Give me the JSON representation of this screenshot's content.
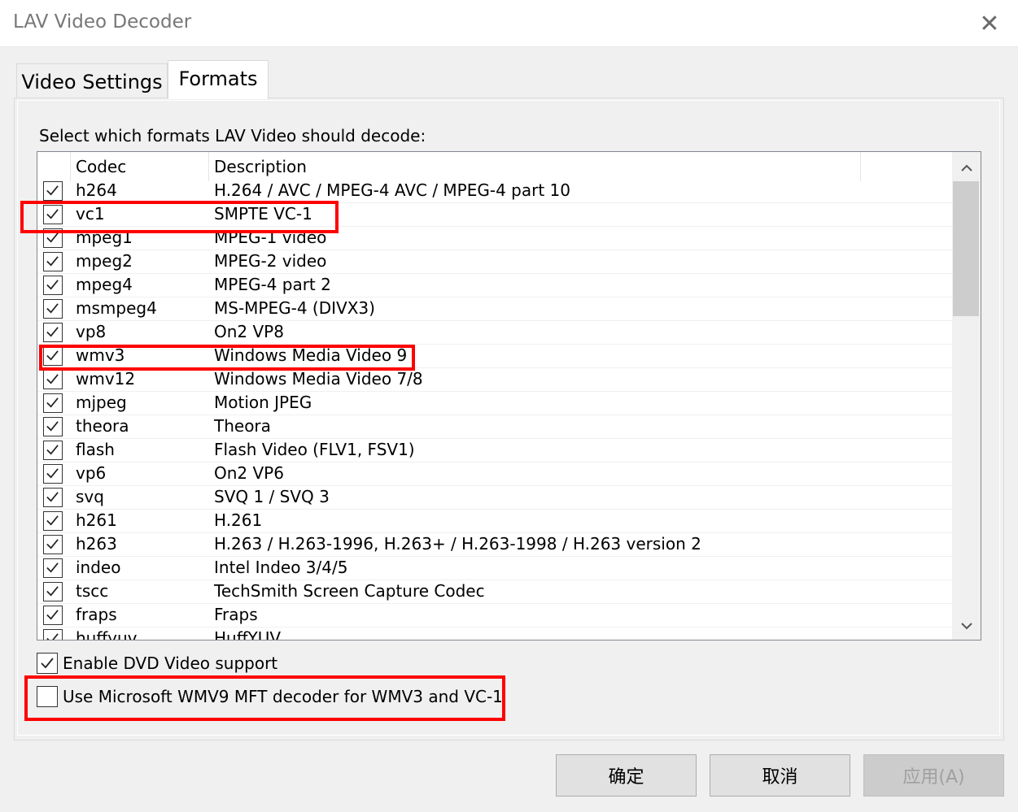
{
  "window": {
    "title": "LAV Video Decoder",
    "close_label": "✕"
  },
  "tabs": [
    {
      "label": "Video Settings",
      "active": false
    },
    {
      "label": "Formats",
      "active": true
    }
  ],
  "instruction": "Select which formats LAV Video should decode:",
  "table": {
    "headers": [
      "Codec",
      "Description"
    ],
    "rows": [
      {
        "codec": "h264",
        "desc": "H.264 / AVC / MPEG-4 AVC / MPEG-4 part 10",
        "checked": true
      },
      {
        "codec": "vc1",
        "desc": "SMPTE VC-1",
        "checked": true
      },
      {
        "codec": "mpeg1",
        "desc": "MPEG-1 video",
        "checked": true
      },
      {
        "codec": "mpeg2",
        "desc": "MPEG-2 video",
        "checked": true
      },
      {
        "codec": "mpeg4",
        "desc": "MPEG-4 part 2",
        "checked": true
      },
      {
        "codec": "msmpeg4",
        "desc": "MS-MPEG-4 (DIVX3)",
        "checked": true
      },
      {
        "codec": "vp8",
        "desc": "On2 VP8",
        "checked": true
      },
      {
        "codec": "wmv3",
        "desc": "Windows Media Video 9",
        "checked": true
      },
      {
        "codec": "wmv12",
        "desc": "Windows Media Video 7/8",
        "checked": true
      },
      {
        "codec": "mjpeg",
        "desc": "Motion JPEG",
        "checked": true
      },
      {
        "codec": "theora",
        "desc": "Theora",
        "checked": true
      },
      {
        "codec": "flash",
        "desc": "Flash Video (FLV1, FSV1)",
        "checked": true
      },
      {
        "codec": "vp6",
        "desc": "On2 VP6",
        "checked": true
      },
      {
        "codec": "svq",
        "desc": "SVQ 1 / SVQ 3",
        "checked": true
      },
      {
        "codec": "h261",
        "desc": "H.261",
        "checked": true
      },
      {
        "codec": "h263",
        "desc": "H.263 / H.263-1996, H.263+ / H.263-1998 / H.263 version 2",
        "checked": true
      },
      {
        "codec": "indeo",
        "desc": "Intel Indeo 3/4/5",
        "checked": true
      },
      {
        "codec": "tscc",
        "desc": "TechSmith Screen Capture Codec",
        "checked": true
      },
      {
        "codec": "fraps",
        "desc": "Fraps",
        "checked": true
      },
      {
        "codec": "huffyuv",
        "desc": "HuffYUV",
        "checked": true
      }
    ]
  },
  "options": {
    "dvd_label": "Enable DVD Video support",
    "dvd_checked": true,
    "wmv9_label": "Use Microsoft WMV9 MFT decoder for WMV3 and VC-1",
    "wmv9_checked": false
  },
  "buttons": {
    "ok": "确定",
    "cancel": "取消",
    "apply": "应用(A)"
  },
  "colors": {
    "highlight": "#ff0000"
  }
}
